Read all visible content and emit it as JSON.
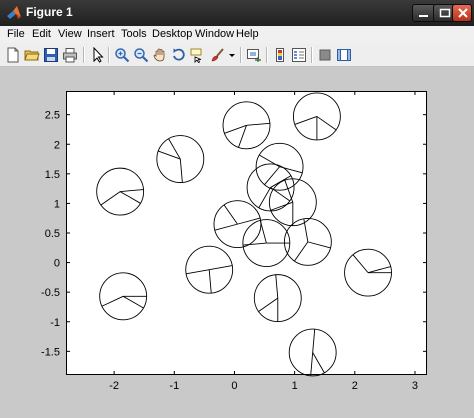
{
  "window": {
    "title": "Figure 1"
  },
  "menu": [
    "File",
    "Edit",
    "View",
    "Insert",
    "Tools",
    "Desktop",
    "Window",
    "Help"
  ],
  "toolbar": [
    "new-figure-icon",
    "open-file-icon",
    "save-icon",
    "print-icon",
    "edit-plot-arrow-icon",
    "zoom-in-icon",
    "zoom-out-icon",
    "pan-hand-icon",
    "rotate-3d-icon",
    "data-cursor-icon",
    "brush-icon",
    "brush-dropdown-icon",
    "link-plot-icon",
    "insert-colorbar-icon",
    "insert-legend-icon",
    "hide-plot-tools-icon",
    "show-plot-tools-icon"
  ],
  "chart_data": {
    "type": "scatter",
    "title": "",
    "xlabel": "",
    "ylabel": "",
    "xlim": [
      -2.8,
      3.2
    ],
    "ylim": [
      -1.9,
      2.9
    ],
    "xticks": [
      -2,
      -1,
      0,
      1,
      2,
      3
    ],
    "xtick_labels": [
      "-2",
      "-1",
      "0",
      "1",
      "2",
      "3"
    ],
    "yticks": [
      -1.5,
      -1,
      -0.5,
      0,
      0.5,
      1,
      1.5,
      2,
      2.5
    ],
    "ytick_labels": [
      "-1.5",
      "-1",
      "-0.5",
      "0",
      "0.5",
      "1",
      "1.5",
      "2",
      "2.5"
    ],
    "grid": false,
    "glyph": "circle with radial spokes",
    "radius": 0.39,
    "points": [
      {
        "x": 1.37,
        "y": 2.47,
        "spokes": [
          200,
          270,
          325
        ]
      },
      {
        "x": 0.2,
        "y": 2.32,
        "spokes": [
          5,
          200,
          250
        ]
      },
      {
        "x": -0.9,
        "y": 1.75,
        "spokes": [
          120,
          275,
          160
        ]
      },
      {
        "x": -1.9,
        "y": 1.2,
        "spokes": [
          5,
          330,
          215
        ]
      },
      {
        "x": 0.75,
        "y": 1.62,
        "spokes": [
          150,
          345,
          230
        ]
      },
      {
        "x": 0.6,
        "y": 1.27,
        "spokes": [
          30,
          325,
          240
        ]
      },
      {
        "x": 0.97,
        "y": 1.02,
        "spokes": [
          110,
          200,
          270
        ]
      },
      {
        "x": 0.05,
        "y": 0.65,
        "spokes": [
          15,
          125,
          195
        ]
      },
      {
        "x": 0.53,
        "y": 0.33,
        "spokes": [
          0,
          105,
          185
        ]
      },
      {
        "x": 1.22,
        "y": 0.35,
        "spokes": [
          345,
          100,
          235
        ]
      },
      {
        "x": -0.42,
        "y": -0.12,
        "spokes": [
          10,
          190,
          275
        ]
      },
      {
        "x": 2.22,
        "y": -0.17,
        "spokes": [
          0,
          15,
          130
        ]
      },
      {
        "x": -1.85,
        "y": -0.57,
        "spokes": [
          0,
          205,
          330
        ]
      },
      {
        "x": 0.72,
        "y": -0.6,
        "spokes": [
          95,
          270,
          215
        ]
      },
      {
        "x": 1.3,
        "y": -1.52,
        "spokes": [
          85,
          300,
          265
        ]
      }
    ]
  }
}
